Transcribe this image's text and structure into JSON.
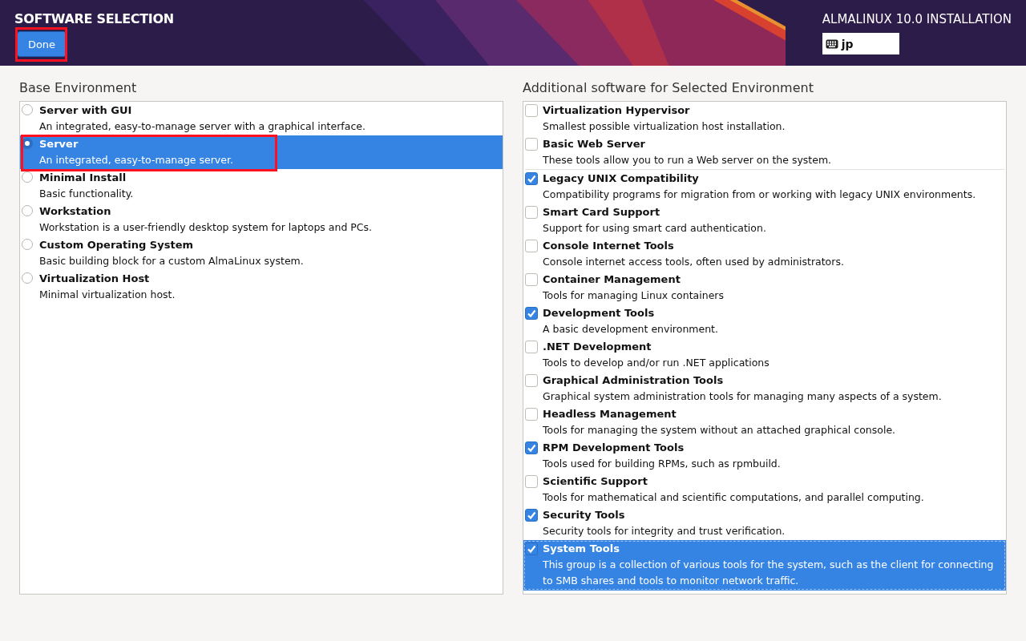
{
  "header": {
    "title": "SOFTWARE SELECTION",
    "done_button": {
      "label": "Done",
      "highlighted": true
    },
    "product": "ALMALINUX 10.0 INSTALLATION",
    "keyboard_layout": "jp"
  },
  "base_environment": {
    "heading": "Base Environment",
    "items": [
      {
        "name": "Server with GUI",
        "description": "An integrated, easy-to-manage server with a graphical interface.",
        "selected": false,
        "highlighted": false
      },
      {
        "name": "Server",
        "description": "An integrated, easy-to-manage server.",
        "selected": true,
        "highlighted": true
      },
      {
        "name": "Minimal Install",
        "description": "Basic functionality.",
        "selected": false,
        "highlighted": false
      },
      {
        "name": "Workstation",
        "description": "Workstation is a user-friendly desktop system for laptops and PCs.",
        "selected": false,
        "highlighted": false
      },
      {
        "name": "Custom Operating System",
        "description": "Basic building block for a custom AlmaLinux system.",
        "selected": false,
        "highlighted": false
      },
      {
        "name": "Virtualization Host",
        "description": "Minimal virtualization host.",
        "selected": false,
        "highlighted": false
      }
    ]
  },
  "additional_software": {
    "heading": "Additional software for Selected Environment",
    "groups": [
      {
        "items": [
          {
            "name": "Virtualization Hypervisor",
            "description": "Smallest possible virtualization host installation.",
            "checked": false,
            "selected": false
          },
          {
            "name": "Basic Web Server",
            "description": "These tools allow you to run a Web server on the system.",
            "checked": false,
            "selected": false
          }
        ]
      },
      {
        "items": [
          {
            "name": "Legacy UNIX Compatibility",
            "description": "Compatibility programs for migration from or working with legacy UNIX environments.",
            "checked": true,
            "selected": false
          },
          {
            "name": "Smart Card Support",
            "description": "Support for using smart card authentication.",
            "checked": false,
            "selected": false
          },
          {
            "name": "Console Internet Tools",
            "description": "Console internet access tools, often used by administrators.",
            "checked": false,
            "selected": false
          },
          {
            "name": "Container Management",
            "description": "Tools for managing Linux containers",
            "checked": false,
            "selected": false
          },
          {
            "name": "Development Tools",
            "description": "A basic development environment.",
            "checked": true,
            "selected": false
          },
          {
            "name": ".NET Development",
            "description": "Tools to develop and/or run .NET applications",
            "checked": false,
            "selected": false
          },
          {
            "name": "Graphical Administration Tools",
            "description": "Graphical system administration tools for managing many aspects of a system.",
            "checked": false,
            "selected": false
          },
          {
            "name": "Headless Management",
            "description": "Tools for managing the system without an attached graphical console.",
            "checked": false,
            "selected": false
          },
          {
            "name": "RPM Development Tools",
            "description": "Tools used for building RPMs, such as rpmbuild.",
            "checked": true,
            "selected": false
          },
          {
            "name": "Scientific Support",
            "description": "Tools for mathematical and scientific computations, and parallel computing.",
            "checked": false,
            "selected": false
          },
          {
            "name": "Security Tools",
            "description": "Security tools for integrity and trust verification.",
            "checked": true,
            "selected": false
          },
          {
            "name": "System Tools",
            "description": "This group is a collection of various tools for the system, such as the client for connecting to SMB shares and tools to monitor network traffic.",
            "checked": true,
            "selected": true
          }
        ]
      }
    ]
  }
}
